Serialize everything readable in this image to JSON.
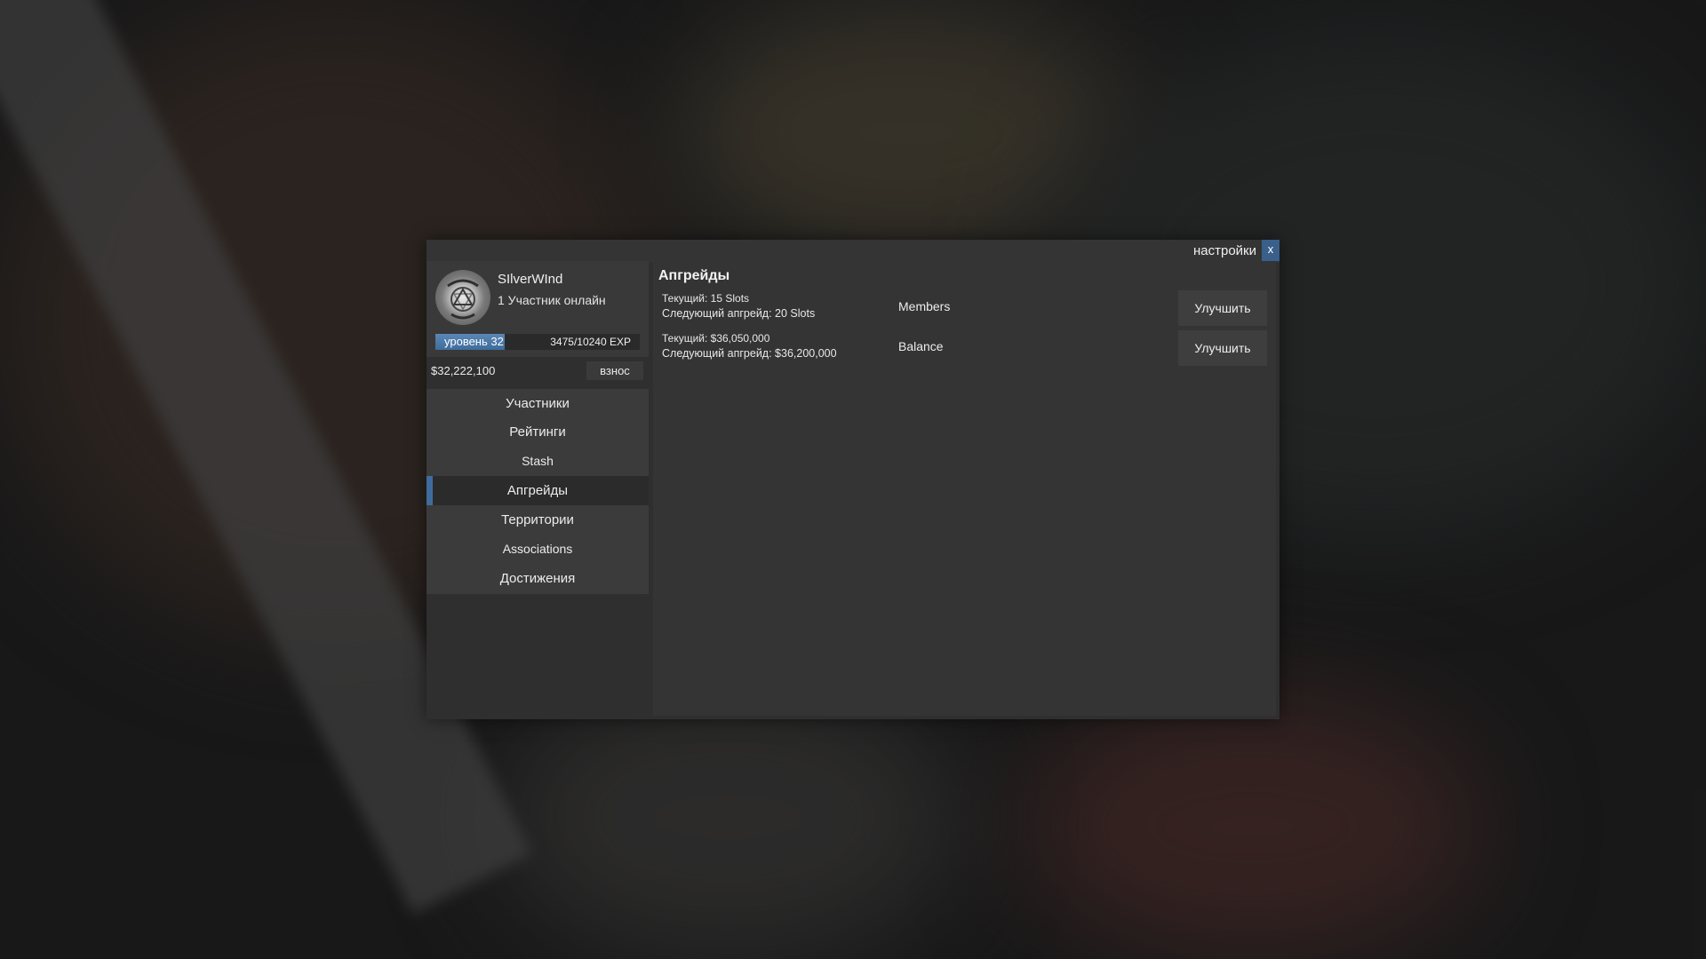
{
  "header": {
    "settings_label": "настройки",
    "close_label": "x"
  },
  "profile": {
    "name": "SIlverWInd",
    "online_text": "1 Участник онлайн",
    "level_text": "уровень 32",
    "exp_text": "3475/10240 EXP",
    "exp_progress": 0.34
  },
  "funds": {
    "amount": "$32,222,100",
    "deposit_label": "взнос"
  },
  "nav": {
    "members": "Участники",
    "ratings": "Рейтинги",
    "stash": "Stash",
    "upgrades": "Апгрейды",
    "territories": "Территории",
    "associations": "Associations",
    "achievements": "Достижения",
    "active": "upgrades"
  },
  "upgrades": {
    "title": "Апгрейды",
    "rows": [
      {
        "current": "Текущий: 15 Slots",
        "next": "Следующий апгрейд: 20 Slots",
        "name": "Members",
        "button": "Улучшить"
      },
      {
        "current": "Текущий: $36,050,000",
        "next": "Следующий апгрейд: $36,200,000",
        "name": "Balance",
        "button": "Улучшить"
      }
    ]
  },
  "colors": {
    "accent": "#3e6c9c",
    "panel": "#2f2f30",
    "button": "#3b3b3c"
  },
  "icons": {
    "avatar": "gang-emblem-icon"
  }
}
